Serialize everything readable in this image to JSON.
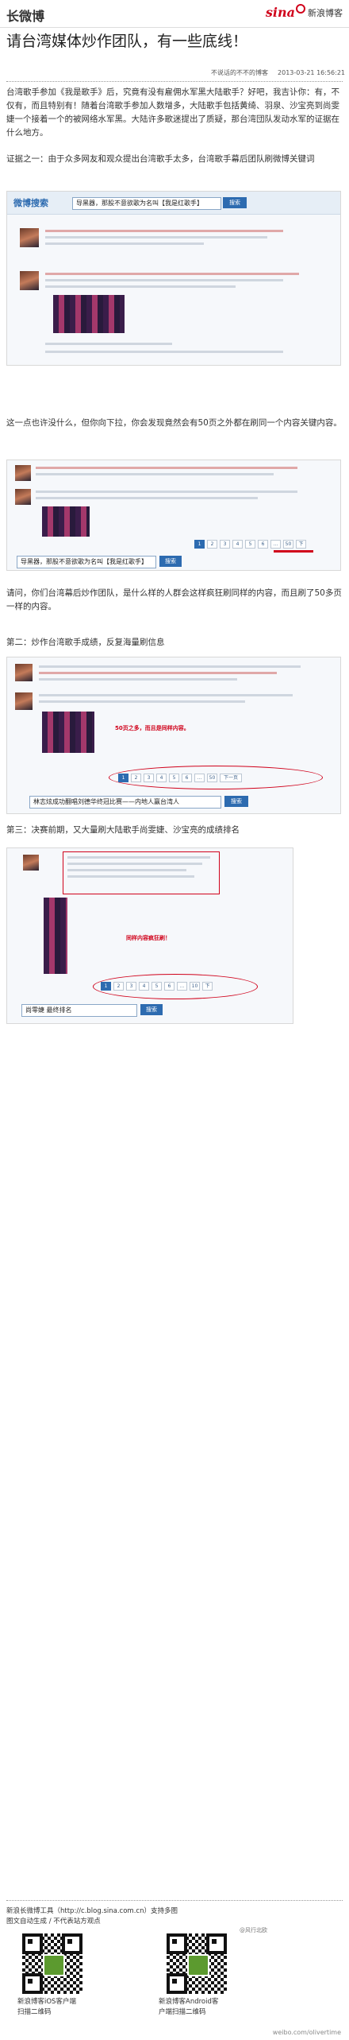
{
  "header": {
    "title": "长微博",
    "brand": "sina",
    "brand_name": "新浪博客"
  },
  "article": {
    "title": "请台湾媒体炒作团队，有一些底线！",
    "author": "不说话的不不的博客",
    "datetime": "2013-03-21 16:56:21",
    "p1": "台湾歌手参加《我是歌手》后，究竟有没有雇佣水军黑大陆歌手？好吧，我吉讣你：有，不仅有，而且特别有！随着台湾歌手参加人数增多，大陆歌手包括黄绮、羽泉、沙宝亮到尚雯婕一个接着一个的被网络水军黑。大陆许多歌迷提出了质疑，那台湾団队发动水军的证据在什么地方。",
    "p2": "证据之一：由于众多网友和观众提出台湾歌手太多，台湾歌手幕后团队刷微博关键词",
    "p3": "这一点也许没什么，但你向下拉，你会发现竟然会有50页之外都在刷同一个内容关键内容。",
    "p4": "请问，你们台湾幕后炒作团队，是什么样的人群会这样疯狂刷同样的内容，而且刷了50多页一样的内容。",
    "p5": "第二：炒作台湾歌手成绩，反复海量刷信息",
    "p6": "第三：决赛前期，又大量刷大陆歌手尚雯婕、沙宝亮的成绩排名"
  },
  "screens": {
    "s1_logo": "微博搜索",
    "s1_query": "导黑器，那股不意欲歌为名叫【我是红歌手】",
    "s1_button": "搜索",
    "s2_pages": [
      "1",
      "2",
      "3",
      "4",
      "5",
      "6",
      "…",
      "50",
      "下"
    ],
    "s2_query": "导黑器，那股不意欲歌为名叫【我是红歌手】",
    "s2_button": "搜索",
    "s3_note": "50页之多，而且是同样内容。",
    "s3_pages": [
      "1",
      "2",
      "3",
      "4",
      "5",
      "6",
      "…",
      "50",
      "下一页"
    ],
    "s3_query": "林志炫成功翻唱刘德华终冠比赛——内地人赢台湾人",
    "s3_button": "搜索",
    "s4_note": "同样内容疯狂刷！",
    "s4_pages": [
      "1",
      "2",
      "3",
      "4",
      "5",
      "6",
      "…",
      "10",
      "下"
    ],
    "s4_query": "尚零婕 最终排名",
    "s4_button": "搜索"
  },
  "footer": {
    "tool_line": "新浪长微博工具（http://c.blog.sina.com.cn）支持多图",
    "tool_line2": "图文自动生成 / 不代表站方观点",
    "watermark": "@风行北欧",
    "ios_caption1": "新浪博客iOS客户端",
    "ios_caption2": "扫描二维码",
    "android_caption1": "新浪博客Android客",
    "android_caption2": "户端扫描二维码",
    "url": "weibo.com/olivertime"
  }
}
